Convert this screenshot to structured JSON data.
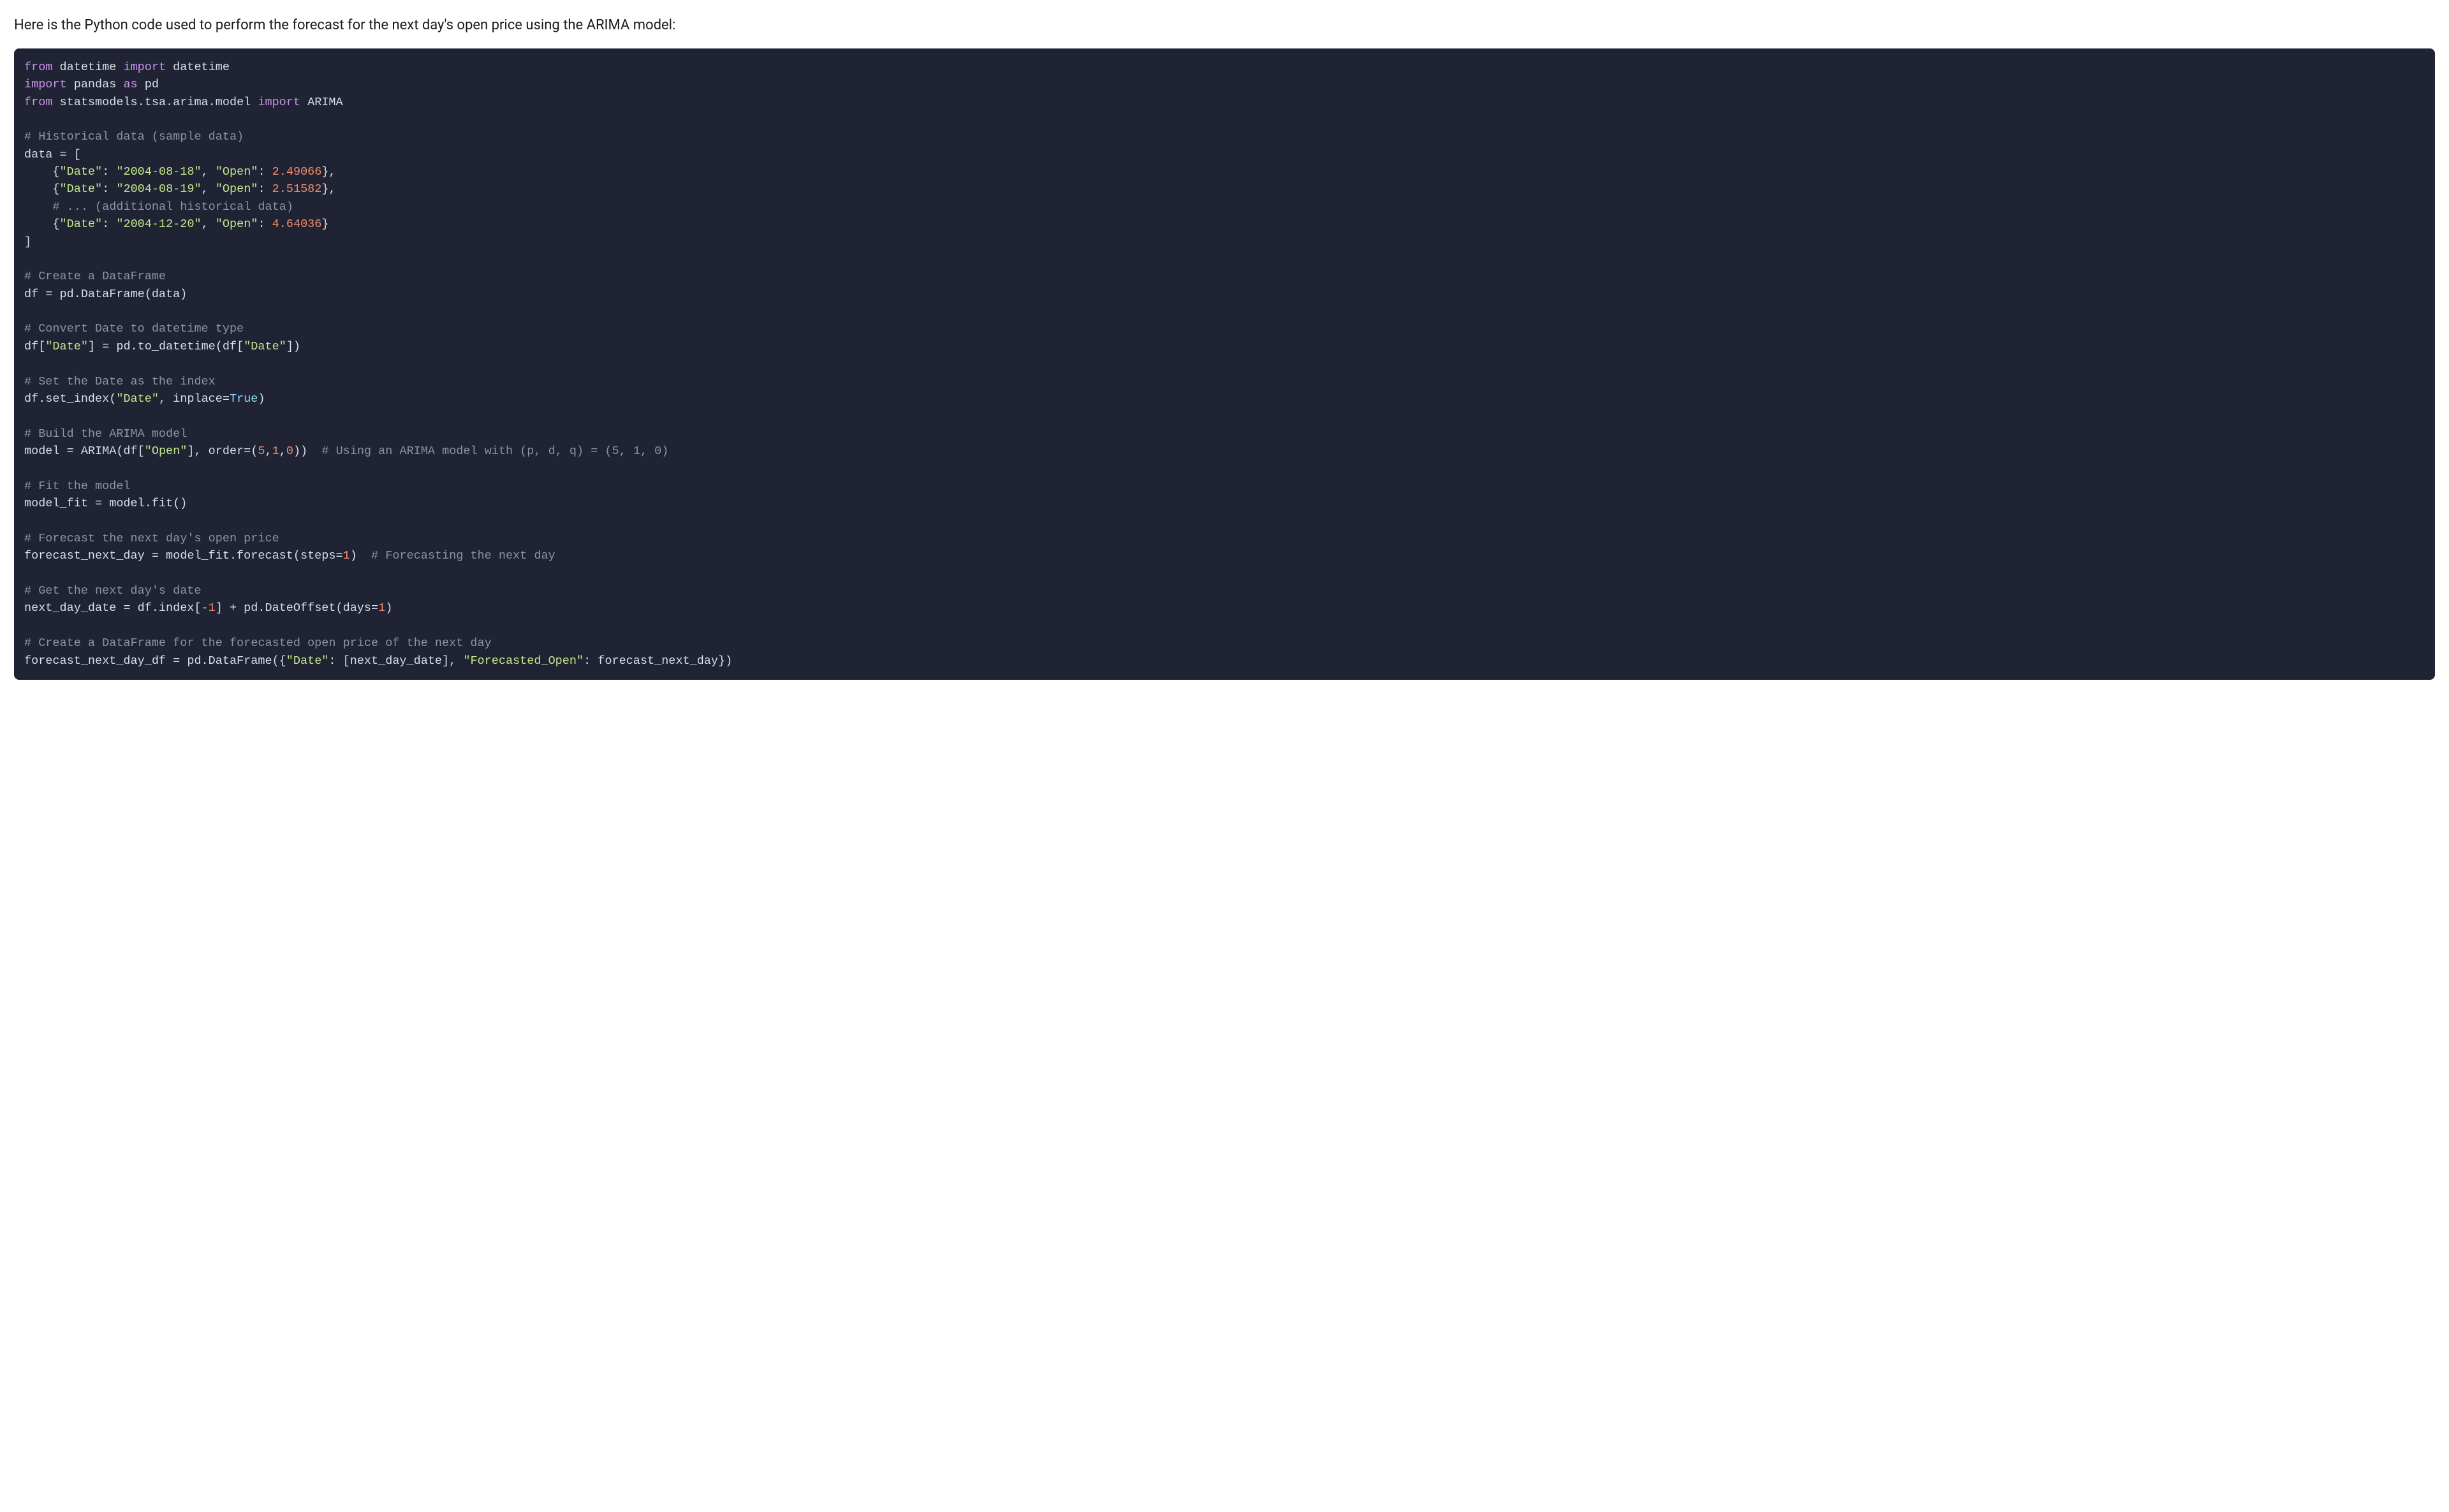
{
  "description": "Here is the Python code used to perform the forecast for the next day's open price using the ARIMA model:",
  "code": {
    "l1_kw1": "from",
    "l1_txt1": " datetime ",
    "l1_kw2": "import",
    "l1_txt2": " datetime",
    "l2_kw1": "import",
    "l2_txt1": " pandas ",
    "l2_kw2": "as",
    "l2_txt2": " pd",
    "l3_kw1": "from",
    "l3_txt1": " statsmodels.tsa.arima.model ",
    "l3_kw2": "import",
    "l3_txt2": " ARIMA",
    "c1": "# Historical data (sample data)",
    "l4": "data = [",
    "l5a": "    {",
    "l5_str1": "\"Date\"",
    "l5b": ": ",
    "l5_str2": "\"2004-08-18\"",
    "l5c": ", ",
    "l5_str3": "\"Open\"",
    "l5d": ": ",
    "l5_num": "2.49066",
    "l5e": "},",
    "l6a": "    {",
    "l6_str1": "\"Date\"",
    "l6b": ": ",
    "l6_str2": "\"2004-08-19\"",
    "l6c": ", ",
    "l6_str3": "\"Open\"",
    "l6d": ": ",
    "l6_num": "2.51582",
    "l6e": "},",
    "c2pre": "    ",
    "c2": "# ... (additional historical data)",
    "l7a": "    {",
    "l7_str1": "\"Date\"",
    "l7b": ": ",
    "l7_str2": "\"2004-12-20\"",
    "l7c": ", ",
    "l7_str3": "\"Open\"",
    "l7d": ": ",
    "l7_num": "4.64036",
    "l7e": "}",
    "l8": "]",
    "c3": "# Create a DataFrame",
    "l9": "df = pd.DataFrame(data)",
    "c4": "# Convert Date to datetime type",
    "l10a": "df[",
    "l10_str1": "\"Date\"",
    "l10b": "] = pd.to_datetime(df[",
    "l10_str2": "\"Date\"",
    "l10c": "])",
    "c5": "# Set the Date as the index",
    "l11a": "df.set_index(",
    "l11_str": "\"Date\"",
    "l11b": ", inplace=",
    "l11_bool": "True",
    "l11c": ")",
    "c6": "# Build the ARIMA model",
    "l12a": "model = ARIMA(df[",
    "l12_str": "\"Open\"",
    "l12b": "], order=(",
    "l12_n1": "5",
    "l12c": ",",
    "l12_n2": "1",
    "l12d": ",",
    "l12_n3": "0",
    "l12e": "))  ",
    "c7": "# Using an ARIMA model with (p, d, q) = (5, 1, 0)",
    "c8": "# Fit the model",
    "l13": "model_fit = model.fit()",
    "c9": "# Forecast the next day's open price",
    "l14a": "forecast_next_day = model_fit.forecast(steps=",
    "l14_num": "1",
    "l14b": ")  ",
    "c10": "# Forecasting the next day",
    "c11": "# Get the next day's date",
    "l15a": "next_day_date = df.index[-",
    "l15_n1": "1",
    "l15b": "] + pd.DateOffset(days=",
    "l15_n2": "1",
    "l15c": ")",
    "c12": "# Create a DataFrame for the forecasted open price of the next day",
    "l16a": "forecast_next_day_df = pd.DataFrame({",
    "l16_str1": "\"Date\"",
    "l16b": ": [next_day_date], ",
    "l16_str2": "\"Forecasted_Open\"",
    "l16c": ": forecast_next_day})"
  }
}
